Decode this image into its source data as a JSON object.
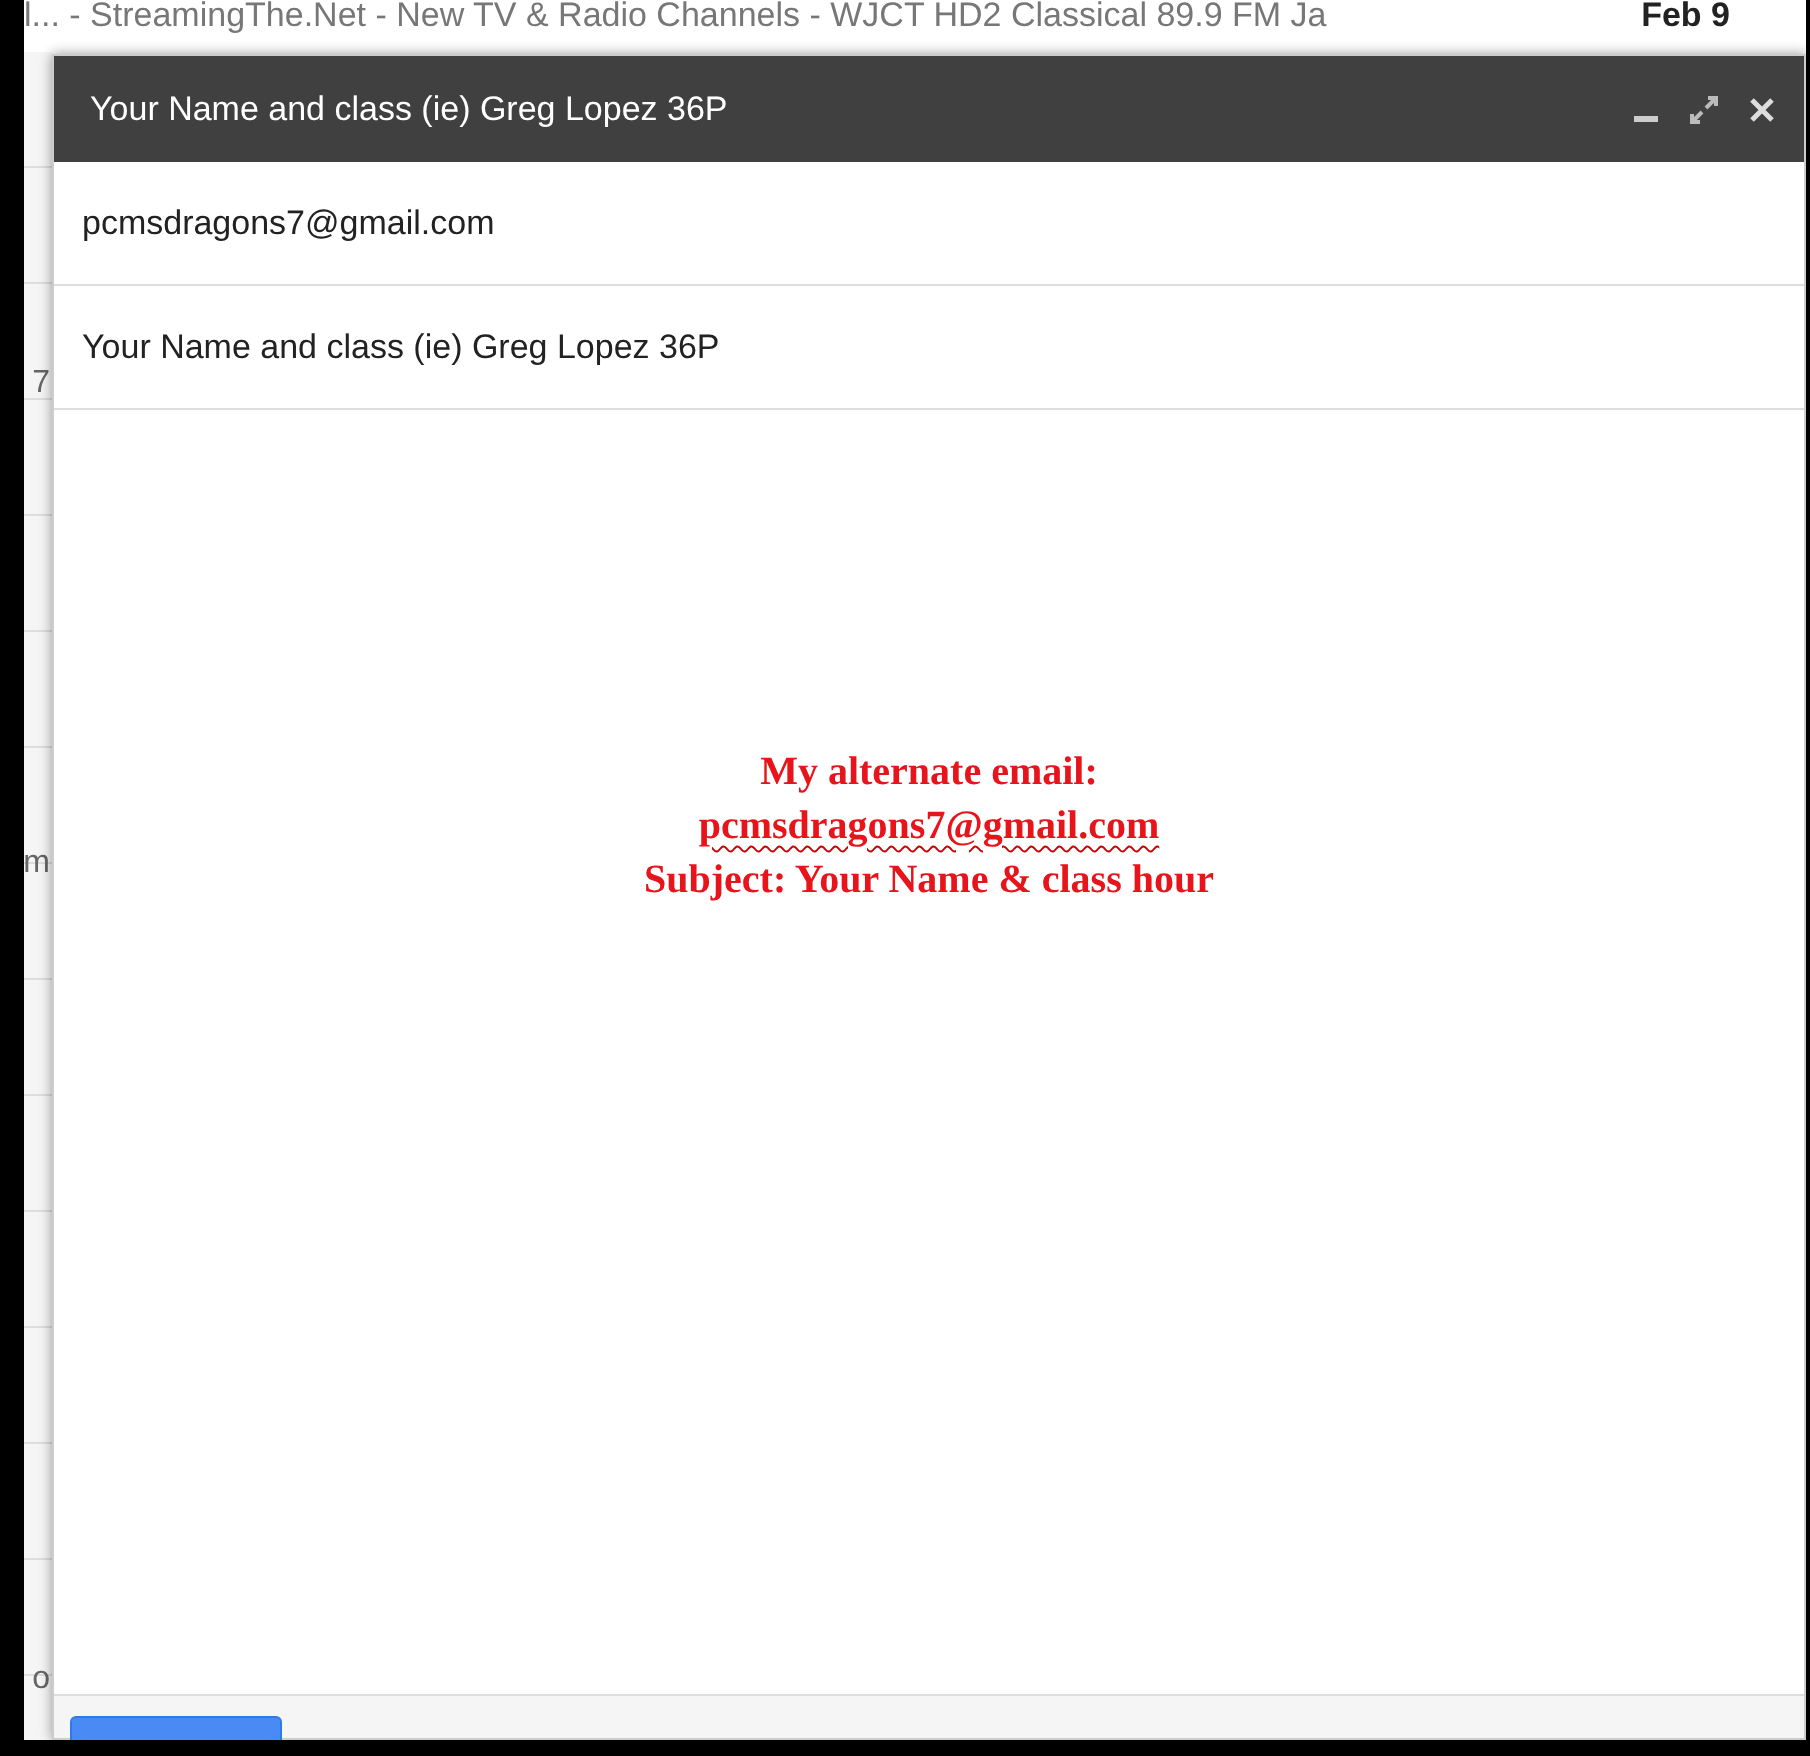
{
  "background_list": {
    "top_row": {
      "subject": "l... - StreamingThe.Net - New TV & Radio Channels - WJCT HD2 Classical 89.9 FM Ja",
      "date": "Feb 9"
    },
    "left_fragments": [
      {
        "text": "7"
      },
      {
        "text": "m"
      },
      {
        "text": "o"
      }
    ]
  },
  "compose": {
    "title": "Your Name and class (ie) Greg Lopez 36P",
    "to": "pcmsdragons7@gmail.com",
    "subject": "Your Name and class (ie) Greg Lopez 36P",
    "body_lines": [
      {
        "text": "My alternate email:",
        "misspelled": false
      },
      {
        "text": "pcmsdragons7@gmail.com",
        "misspelled": true
      },
      {
        "text": "Subject: Your Name & class hour",
        "misspelled": false
      }
    ]
  }
}
